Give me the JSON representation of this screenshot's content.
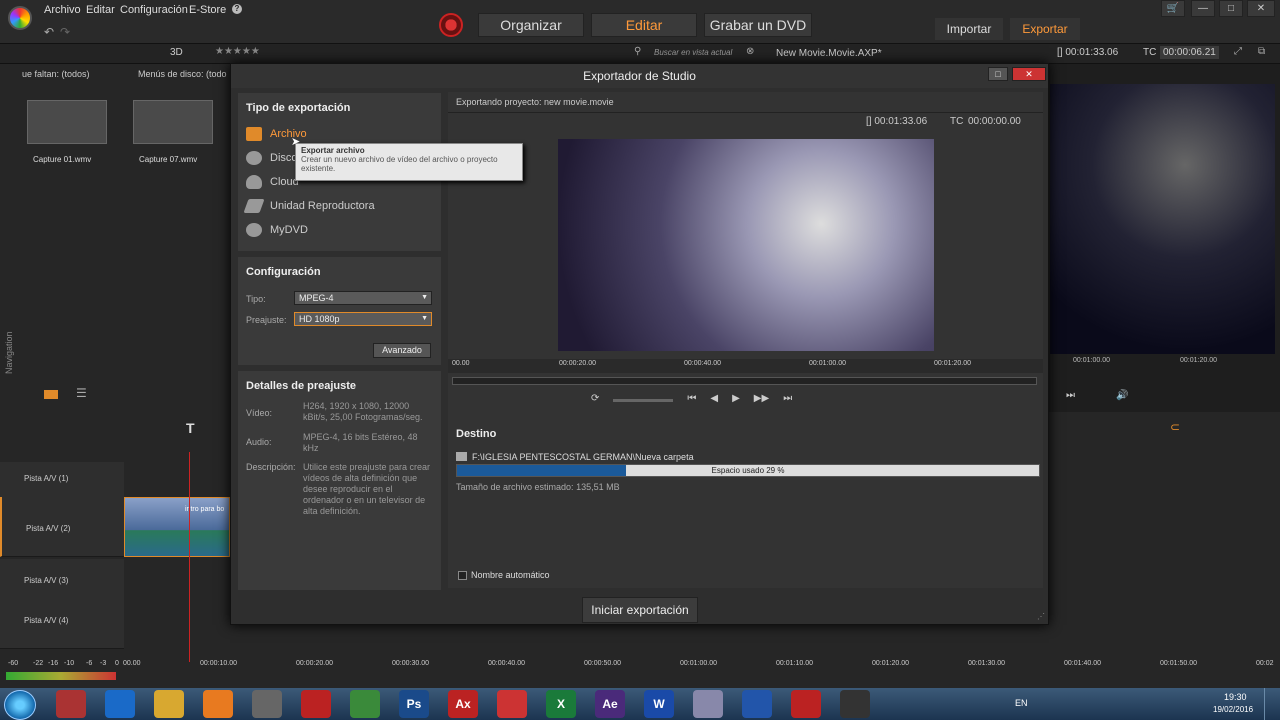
{
  "app": {
    "menu": [
      "Archivo",
      "Editar",
      "Configuración",
      "E-Store"
    ],
    "help_icon": "?",
    "nav": [
      "Organizar",
      "Editar",
      "Grabar un DVD"
    ],
    "import_label": "Importar",
    "export_label": "Exportar",
    "timecode1": "[] 00:01:33.06",
    "tc_label": "TC",
    "timecode2": "00:00:06.21",
    "search_placeholder": "Buscar en vista actual",
    "project_name": "New Movie.Movie.AXP*",
    "threed_label": "3D",
    "tab_missing": "ue faltan: (todos)",
    "tab_disc_menus": "Menús de disco: (todo",
    "navigation_label": "Navigation",
    "clips": [
      "Capture 01.wmv",
      "Capture 07.wmv"
    ],
    "accent_color": "#ff9a3a"
  },
  "tracks": [
    {
      "label": "Pista A/V (1)"
    },
    {
      "label": "Pista A/V (2)"
    },
    {
      "label": "Pista A/V (3)"
    },
    {
      "label": "Pista A/V (4)"
    }
  ],
  "clip_title": "intro para bo",
  "timeline_ruler": [
    "00.00",
    "00:00:10.00",
    "00:00:20.00",
    "00:00:30.00",
    "00:00:40.00",
    "00:00:50.00",
    "00:01:00.00",
    "00:01:10.00",
    "00:01:20.00",
    "00:01:30.00",
    "00:01:40.00",
    "00:01:50.00",
    "00:02"
  ],
  "meter_labels": [
    "-60",
    "-22",
    "-16",
    "-10",
    "-6",
    "-3",
    "0"
  ],
  "right_preview_ruler": [
    "00:01:00.00",
    "00:01:20.00"
  ],
  "dialog": {
    "title": "Exportador de Studio",
    "export_type_title": "Tipo de exportación",
    "export_types": [
      "Archivo",
      "Disco",
      "Cloud",
      "Unidad Reproductora",
      "MyDVD"
    ],
    "config_title": "Configuración",
    "type_label": "Tipo:",
    "type_value": "MPEG-4",
    "preset_label": "Preajuste:",
    "preset_value": "HD 1080p",
    "advanced_button": "Avanzado",
    "details_title": "Detalles de preajuste",
    "video_label": "Vídeo:",
    "video_value": "H264, 1920 x 1080, 12000 kBit/s, 25,00 Fotogramas/seg.",
    "audio_label": "Audio:",
    "audio_value": "MPEG-4, 16 bits Estéreo, 48 kHz",
    "desc_label": "Descripción:",
    "desc_value": "Utilice este preajuste para crear vídeos de alta definición que desee reproducir en el ordenador o en un televisor de alta definición.",
    "exporting_project": "Exportando proyecto: new movie.movie",
    "preview_timecode": "[] 00:01:33.06",
    "preview_tc_label": "TC",
    "preview_tc_value": "00:00:00.00",
    "ruler": [
      "00.00",
      "00:00:20.00",
      "00:00:40.00",
      "00:01:00.00",
      "00:01:20.00"
    ],
    "tooltip_title": "Exportar archivo",
    "tooltip_text": "Crear un nuevo archivo de vídeo del archivo o proyecto existente.",
    "destination_title": "Destino",
    "destination_path": "F:\\IGLESIA PENTESCOSTAL  GERMAN\\Nueva carpeta",
    "space_used_label": "Espacio usado 29 %",
    "space_used_fraction": 0.29,
    "estimated_size": "Tamaño de archivo estimado: 135,51 MB",
    "auto_name_label": "Nombre automático",
    "start_button": "Iniciar exportación"
  },
  "taskbar": {
    "lang": "EN",
    "time": "19:30",
    "date": "19/02/2016",
    "apps": [
      "pinnacle-icon",
      "ie-icon",
      "explorer-icon",
      "media-player-icon",
      "clapper-icon",
      "video-icon",
      "chrome-icon",
      "photoshop-icon",
      "acrobat-x-icon",
      "scissors-icon",
      "excel-icon",
      "after-effects-icon",
      "word-icon",
      "pen-icon",
      "bluetooth-icon",
      "adobe-icon",
      "pinnacle-active-icon"
    ],
    "app_glyphs": {
      "photoshop-icon": "Ps",
      "acrobat-x-icon": "Ax",
      "excel-icon": "X",
      "after-effects-icon": "Ae",
      "word-icon": "W"
    }
  }
}
